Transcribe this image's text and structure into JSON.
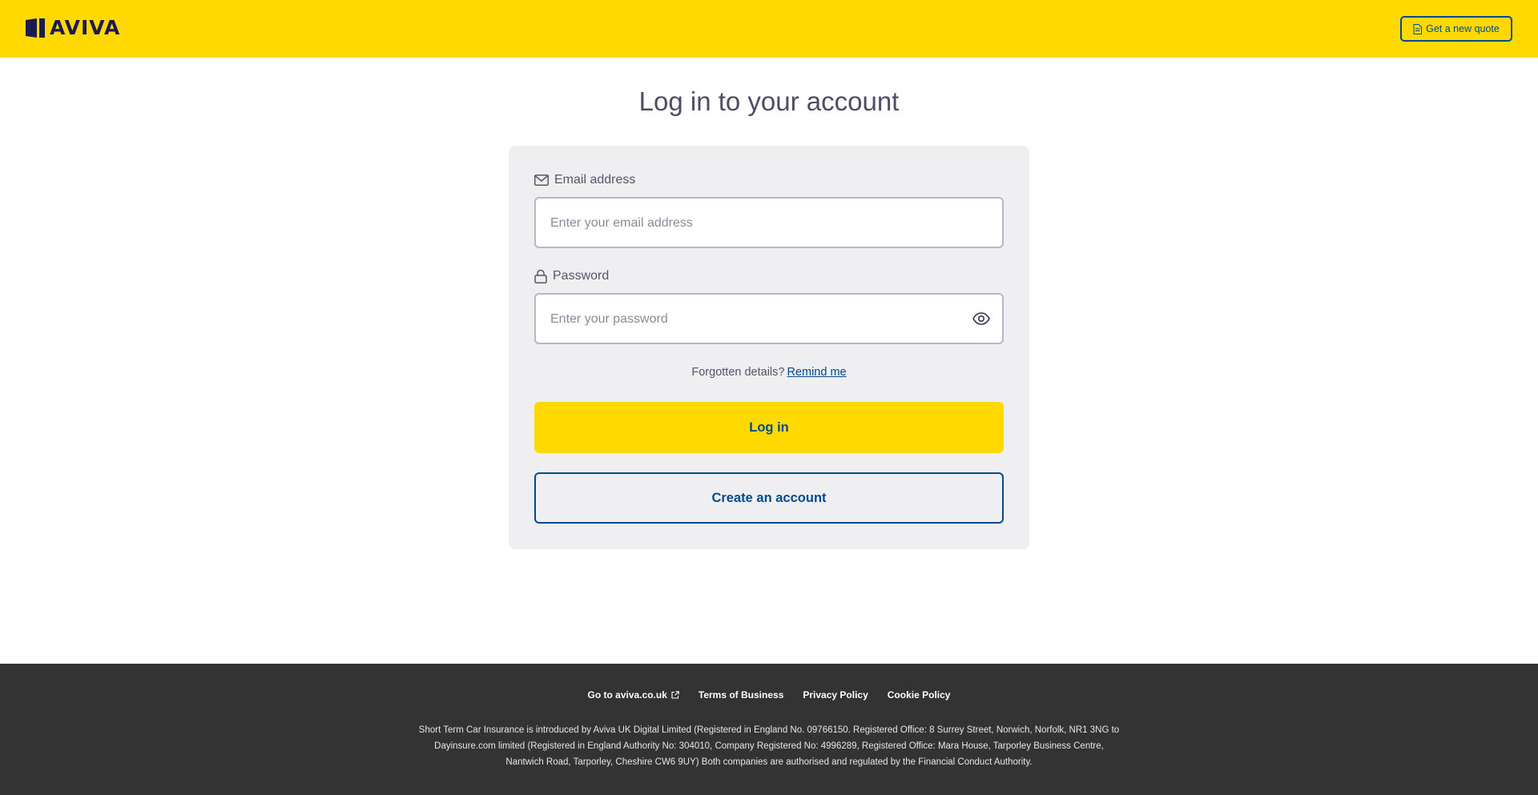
{
  "header": {
    "brand": "AVIVA",
    "quote_button": "Get a new quote"
  },
  "main": {
    "title": "Log in to your account",
    "email": {
      "label": "Email address",
      "placeholder": "Enter your email address"
    },
    "password": {
      "label": "Password",
      "placeholder": "Enter your password"
    },
    "forgot_text": "Forgotten details?",
    "remind_link": "Remind me",
    "login_button": "Log in",
    "create_button": "Create an account"
  },
  "footer": {
    "links": [
      "Go to aviva.co.uk",
      "Terms of Business",
      "Privacy Policy",
      "Cookie Policy"
    ],
    "legal_lines": [
      "Short Term Car Insurance is introduced by Aviva UK Digital Limited (Registered in England No. 09766150. Registered Office: 8 Surrey Street, Norwich, Norfolk, NR1 3NG to",
      "Dayinsure.com limited (Registered in England Authority No: 304010, Company Registered No: 4996289, Registered Office: Mara House, Tarporley Business Centre,",
      "Nantwich Road, Tarporley, Cheshire CW6 9UY) Both companies are authorised and regulated by the Financial Conduct Authority."
    ]
  },
  "colors": {
    "brand_yellow": "#ffd900",
    "link_blue": "#004a8f",
    "footer_bg": "#333333"
  },
  "icons": [
    "aviva-logo-icon",
    "document-icon",
    "envelope-icon",
    "lock-icon",
    "eye-icon",
    "external-link-icon"
  ]
}
